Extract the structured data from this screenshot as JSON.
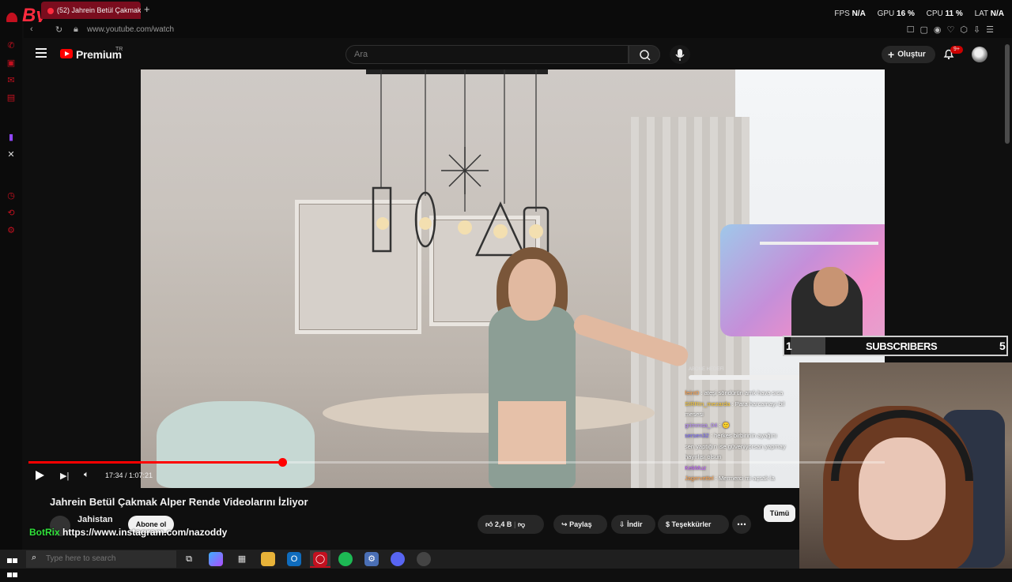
{
  "browser": {
    "logo_text": "By",
    "tab_title": "(52) Jahrein Betül Çakmak",
    "new_tab_icon": "plus-icon",
    "url": "www.youtube.com/watch",
    "stats": [
      {
        "label": "FPS",
        "value": "N/A"
      },
      {
        "label": "GPU",
        "value": "16 %"
      },
      {
        "label": "CPU",
        "value": "11 %"
      },
      {
        "label": "LAT",
        "value": "N/A"
      }
    ],
    "accent": "#c3101f"
  },
  "youtube": {
    "brand": "Premium",
    "region": "TR",
    "search_placeholder": "Ara",
    "create_label": "Oluştur",
    "notifications_badge": "9+",
    "accent": "#ff0000"
  },
  "player": {
    "time": "17:34 / 1:07:21",
    "progress_fraction": 0.296
  },
  "overlay": {
    "subs_current": "1",
    "subs_label": "SUBSCRIBERS",
    "subs_goal": "5",
    "goal_label": "ABONE HEDEFİ",
    "chat": [
      {
        "user": "feint0",
        "color": "#ffa34d",
        "text": "ateşi söndürün amk hava sıca"
      },
      {
        "user": "SIRRIn_mezarda",
        "color": "#ffcc33",
        "text": "Para harcamayı bil"
      },
      {
        "user": "",
        "color": "#ffffff",
        "text": "mesesi"
      },
      {
        "user": "grimmsa_04",
        "color": "#b98cff",
        "text": "🙂"
      },
      {
        "user": "sersen32",
        "color": "#7d6cff",
        "text": "herkes birbirinin ayağını"
      },
      {
        "user": "",
        "color": "#ffffff",
        "text": "sen yaptığın ise güveniyorsan yapmay"
      },
      {
        "user": "",
        "color": "#ffffff",
        "text": "hayırlısı olsun"
      },
      {
        "user": "KekMuz",
        "color": "#c05cff",
        "text": ""
      },
      {
        "user": "Jagervettel",
        "color": "#ffa34d",
        "text": "Mermerci mi açsak la"
      }
    ]
  },
  "video_info": {
    "title": "Jahrein Betül Çakmak Alper Rende Videolarını İzliyor",
    "channel": "Jahistan",
    "subscribe_label": "Abone ol",
    "likes": "2,4 B",
    "share_label": "Paylaş",
    "download_label": "İndir",
    "thanks_label": "Teşekkürler",
    "all_label": "Tümü",
    "bot_name": "BotRix",
    "bot_link": "https://www.instagram.com/nazoddy"
  },
  "taskbar": {
    "search_placeholder": "Type here to search"
  }
}
